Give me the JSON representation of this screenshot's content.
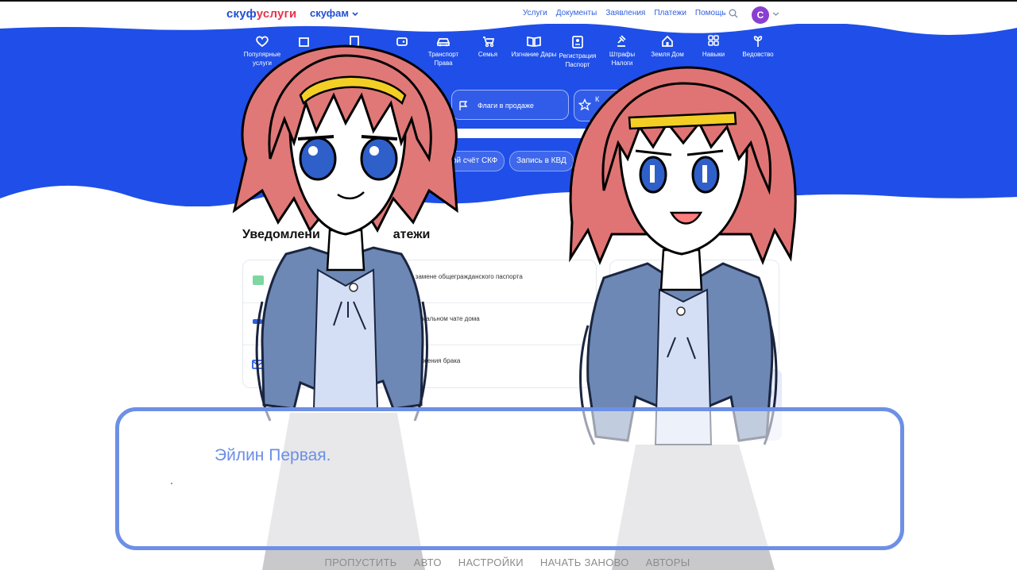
{
  "header": {
    "logo_part1": "скуф",
    "logo_part2": "услуги",
    "fam": "скуфам",
    "nav": [
      "Услуги",
      "Документы",
      "Заявления",
      "Платежи",
      "Помощь"
    ],
    "avatar_letter": "С"
  },
  "categories": [
    {
      "label": "Популярные услуги",
      "icon": "heart-icon"
    },
    {
      "label": "",
      "icon": "puzzle-icon"
    },
    {
      "label": "",
      "icon": "doc-icon"
    },
    {
      "label": "",
      "icon": "wallet-icon"
    },
    {
      "label": "Транспорт Права",
      "icon": "car-icon"
    },
    {
      "label": "Семья",
      "icon": "stroller-icon"
    },
    {
      "label": "Изгнание Дары",
      "icon": "book-icon"
    },
    {
      "label": "Регистрация Паспорт",
      "icon": "id-card-icon"
    },
    {
      "label": "Штрафы Налоги",
      "icon": "gavel-icon"
    },
    {
      "label": "Земля Дом",
      "icon": "house-icon"
    },
    {
      "label": "Навыки",
      "icon": "grid-icon"
    },
    {
      "label": "Ведовство",
      "icon": "plant-icon"
    }
  ],
  "promo": {
    "flags_label": "Флаги в продаже",
    "second_label": "К"
  },
  "chips": [
    "ой счёт СКФ",
    "Запись в КВД"
  ],
  "notifications": {
    "title_visible": "Уведомлени",
    "title_tail": "атежи",
    "rows": [
      {
        "text": "о замене  общегражданского паспорта",
        "icon": "passport-icon"
      },
      {
        "text": "фициальном чате дома",
        "icon": "chat-icon"
      },
      {
        "text": "сторжения брака",
        "icon": "mail-icon"
      }
    ]
  },
  "dialogue": {
    "speaker": "Эйлин Первая.",
    "text": ""
  },
  "quick_menu": [
    "ПРОПУСТИТЬ",
    "АВТО",
    "НАСТРОЙКИ",
    "НАЧАТЬ ЗАНОВО",
    "АВТОРЫ"
  ],
  "colors": {
    "band_blue": "#1f4fe8",
    "dialog_border": "#6d90e6",
    "speaker": "#6b8fe6",
    "quick_menu": "#8c8c8c",
    "jacket": "#6d88b4",
    "hair": "#e07474",
    "headband": "#f3cf26"
  }
}
